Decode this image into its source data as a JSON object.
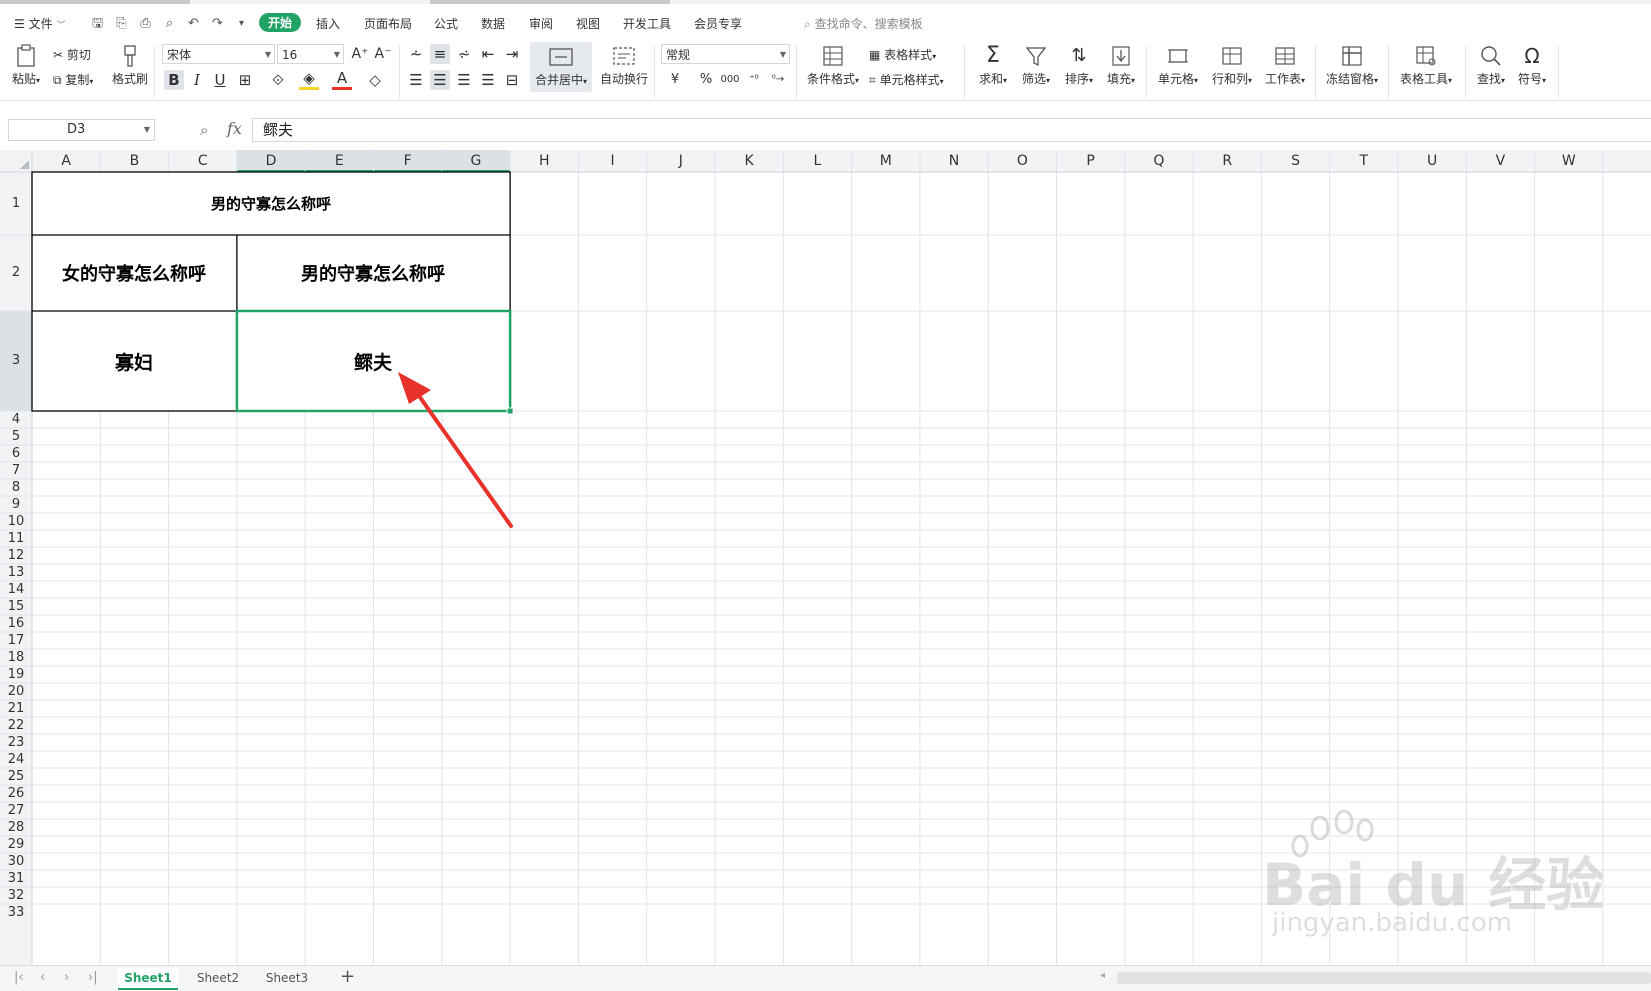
{
  "menu": {
    "file_label": "文件",
    "tabs": [
      "开始",
      "插入",
      "页面布局",
      "公式",
      "数据",
      "审阅",
      "视图",
      "开发工具",
      "会员专享"
    ],
    "active_tab": "开始",
    "search_placeholder": "查找命令、搜索模板"
  },
  "ribbon": {
    "paste": "粘贴",
    "cut": "剪切",
    "copy": "复制",
    "format_painter": "格式刷",
    "font_name": "宋体",
    "font_size": "16",
    "merge_center": "合并居中",
    "wrap_text": "自动换行",
    "number_format": "常规",
    "conditional_format": "条件格式",
    "table_style": "表格样式",
    "cell_style": "单元格样式",
    "sum": "求和",
    "filter": "筛选",
    "sort": "排序",
    "fill": "填充",
    "cells": "单元格",
    "rows_cols": "行和列",
    "worksheet": "工作表",
    "freeze": "冻结窗格",
    "table_tools": "表格工具",
    "find": "查找",
    "symbol": "符号",
    "currency_symbol": "¥",
    "percent_symbol": "%",
    "thousands_symbol": "000"
  },
  "formula_bar": {
    "name_box": "D3",
    "fx": "fx",
    "content": "鳏夫"
  },
  "grid": {
    "columns": [
      "A",
      "B",
      "C",
      "D",
      "E",
      "F",
      "G",
      "H",
      "I",
      "J",
      "K",
      "L",
      "M",
      "N",
      "O",
      "P",
      "Q",
      "R",
      "S",
      "T",
      "U",
      "V",
      "W"
    ],
    "rows": [
      "1",
      "2",
      "3",
      "4",
      "5",
      "6",
      "7",
      "8",
      "9",
      "10",
      "11",
      "12",
      "13",
      "14",
      "15",
      "16",
      "17",
      "18",
      "19",
      "20",
      "21",
      "22",
      "23",
      "24",
      "25",
      "26",
      "27",
      "28",
      "29",
      "30",
      "31",
      "32",
      "33"
    ],
    "selected_cell": "D3",
    "cells": {
      "title": "男的守寡怎么称呼",
      "header_left": "女的守寡怎么称呼",
      "header_right": "男的守寡怎么称呼",
      "value_left": "寡妇",
      "value_right": "鳏夫"
    }
  },
  "sheets": {
    "tabs": [
      "Sheet1",
      "Sheet2",
      "Sheet3"
    ],
    "active": "Sheet1"
  },
  "watermark": {
    "brand": "Bai du 经验",
    "url": "jingyan.baidu.com"
  },
  "colors": {
    "accent": "#21a366",
    "selection_border": "#21a366",
    "arrow": "#e8332a",
    "gridline": "#dfe3ec"
  }
}
